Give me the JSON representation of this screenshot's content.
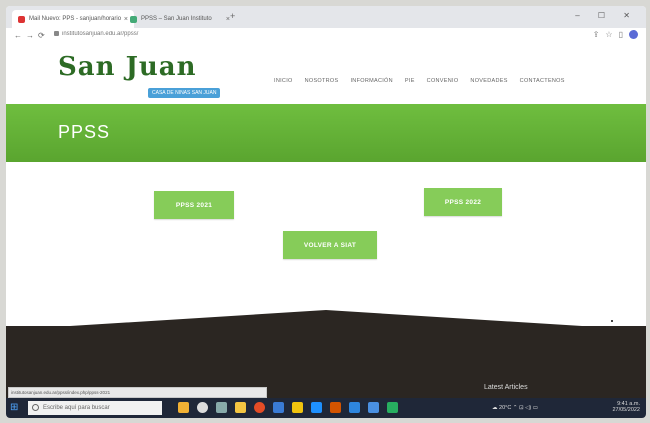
{
  "browser": {
    "tabs": [
      {
        "title": "Mail Nuevo: PPS - sanjuan/horario",
        "close": "×"
      },
      {
        "title": "PPSS – San Juan Instituto",
        "close": "×"
      }
    ],
    "new_tab": "+",
    "window_controls": "–  ☐  ✕",
    "url": "institutosanjuan.edu.ar/ppss/",
    "back": "←",
    "forward": "→",
    "reload": "⟳"
  },
  "site": {
    "logo": "San Juan",
    "logo_tagline": "CASA DE NINAS SAN JUAN",
    "menu": [
      "INICIO",
      "NOSOTROS",
      "INFORMACIÓN",
      "PIE",
      "CONVENIO",
      "NOVEDADES",
      "CONTACTENOS"
    ],
    "page_title": "PPSS",
    "buttons": {
      "ppss_2021": "PPSS 2021",
      "ppss_2022": "PPSS 2022",
      "volver": "VOLVER A SIAT"
    },
    "latest_articles": "Latest Articles"
  },
  "status_bar": {
    "link_url": "institutosanjuan.edu.ar/ppss/index.php/ppss-2021"
  },
  "taskbar": {
    "search_placeholder": "Escribe aquí para buscar",
    "weather": "20°C",
    "time": "9:41 a.m.",
    "date": "27/05/2022"
  },
  "colors": {
    "brand_green": "#2d6b25",
    "hero_green": "#6fbe3f",
    "button_green": "#86cc59",
    "footer_dark": "#2b2622",
    "tagline_blue": "#4aa0d8"
  }
}
